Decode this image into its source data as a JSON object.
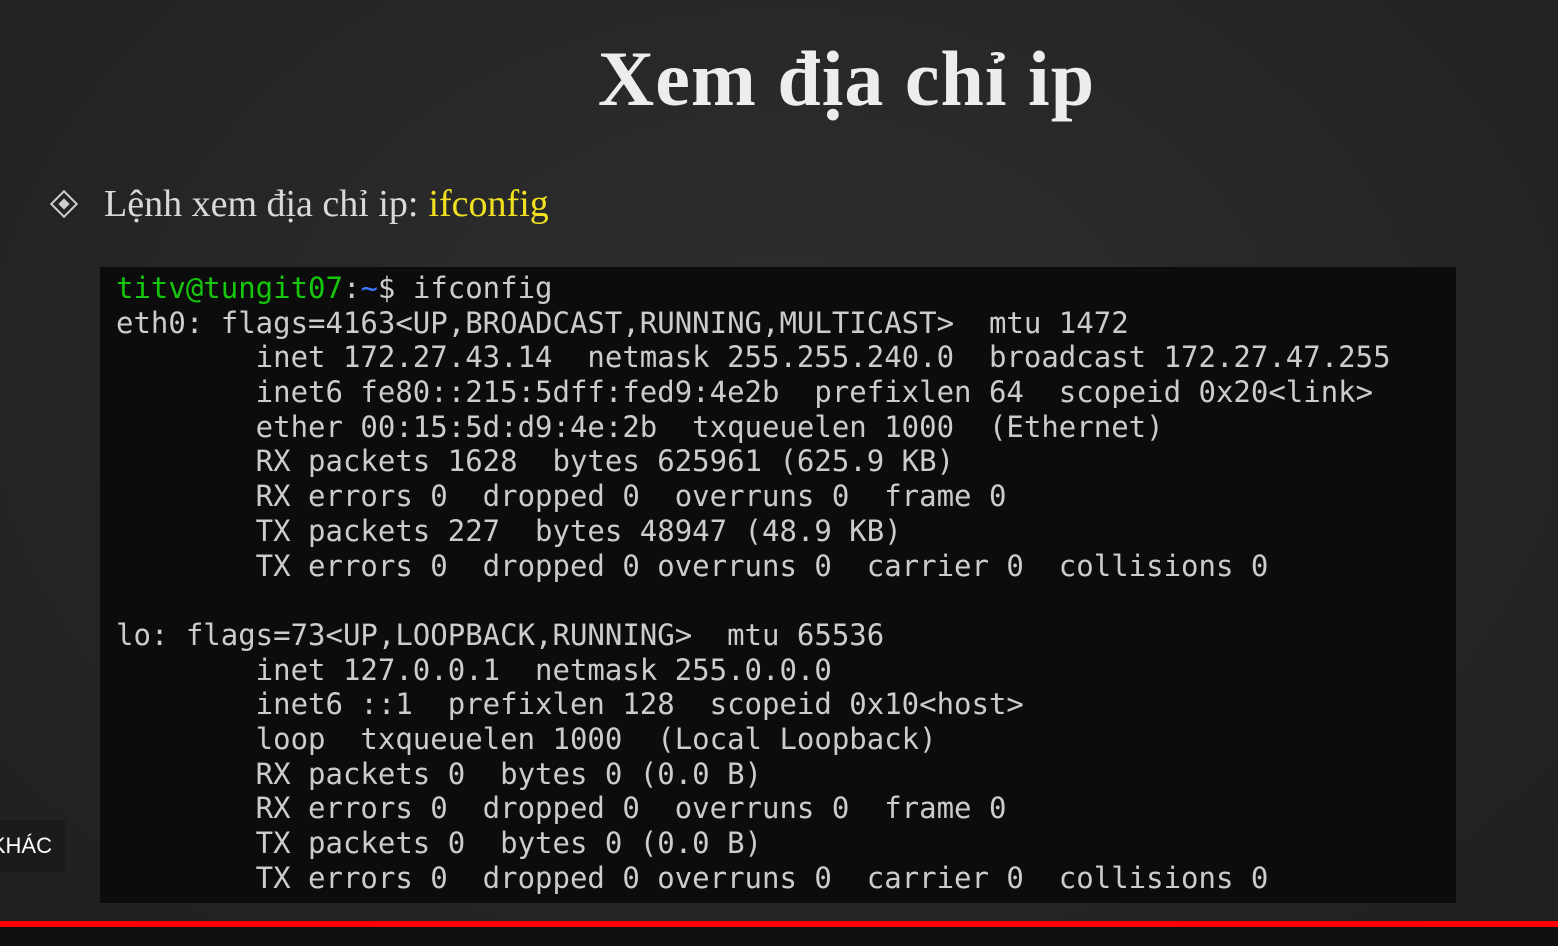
{
  "slide": {
    "title": "Xem địa chỉ ip",
    "bullet_text": "Lệnh xem địa chỉ ip:",
    "bullet_command": "ifconfig"
  },
  "terminal": {
    "prompt_user": "titv@tungit07",
    "prompt_sep": ":",
    "prompt_path": "~",
    "prompt_symbol": "$ ",
    "command": "ifconfig",
    "lines": [
      "eth0: flags=4163<UP,BROADCAST,RUNNING,MULTICAST>  mtu 1472",
      "        inet 172.27.43.14  netmask 255.255.240.0  broadcast 172.27.47.255",
      "        inet6 fe80::215:5dff:fed9:4e2b  prefixlen 64  scopeid 0x20<link>",
      "        ether 00:15:5d:d9:4e:2b  txqueuelen 1000  (Ethernet)",
      "        RX packets 1628  bytes 625961 (625.9 KB)",
      "        RX errors 0  dropped 0  overruns 0  frame 0",
      "        TX packets 227  bytes 48947 (48.9 KB)",
      "        TX errors 0  dropped 0 overruns 0  carrier 0  collisions 0",
      "",
      "lo: flags=73<UP,LOOPBACK,RUNNING>  mtu 65536",
      "        inet 127.0.0.1  netmask 255.0.0.0",
      "        inet6 ::1  prefixlen 128  scopeid 0x10<host>",
      "        loop  txqueuelen 1000  (Local Loopback)",
      "        RX packets 0  bytes 0 (0.0 B)",
      "        RX errors 0  dropped 0  overruns 0  frame 0",
      "        TX packets 0  bytes 0 (0.0 B)",
      "        TX errors 0  dropped 0 overruns 0  carrier 0  collisions 0"
    ]
  },
  "overlay": {
    "side_badge": "KHÁC"
  },
  "colors": {
    "prompt_user": "#16c60c",
    "prompt_path": "#3b78ff",
    "command_highlight": "#f0e020",
    "progress": "#ff0000"
  }
}
